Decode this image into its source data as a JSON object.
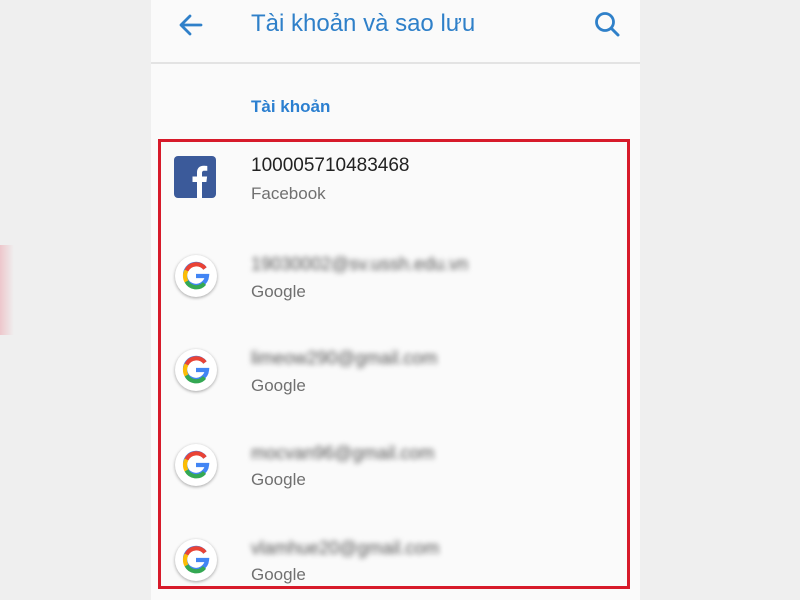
{
  "header": {
    "title": "Tài khoản và sao lưu",
    "back_icon": "arrow-left-icon",
    "search_icon": "search-icon",
    "accent": "#2f80c9"
  },
  "section_title": "Tài khoản",
  "highlight_color": "#d71a2a",
  "accounts": [
    {
      "name": "100005710483468",
      "type": "Facebook",
      "icon": "facebook-icon"
    },
    {
      "name": "19030002@sv.ussh.edu.vn",
      "type": "Google",
      "icon": "google-icon"
    },
    {
      "name": "limeow290@gmail.com",
      "type": "Google",
      "icon": "google-icon"
    },
    {
      "name": "mocvan96@gmail.com",
      "type": "Google",
      "icon": "google-icon"
    },
    {
      "name": "vlamhue20@gmail.com",
      "type": "Google",
      "icon": "google-icon"
    }
  ]
}
